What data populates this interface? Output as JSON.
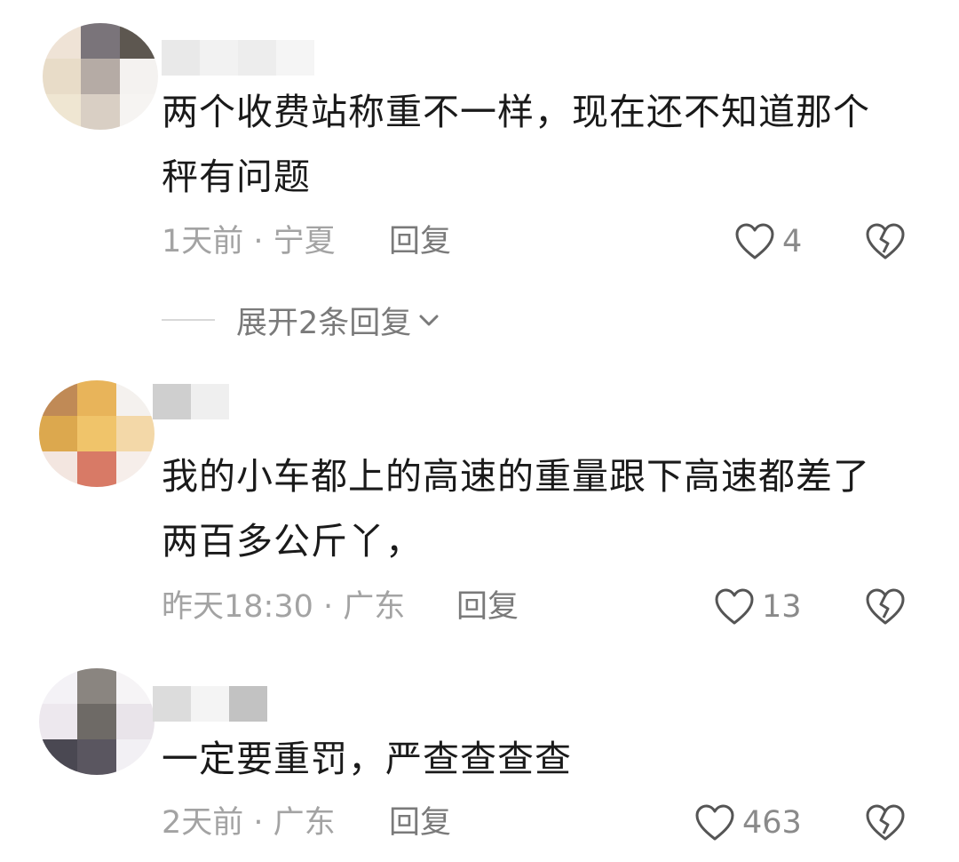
{
  "comments": [
    {
      "text": "两个收费站称重不一样，现在还不知道那个秤有问题",
      "time": "1天前 · 宁夏",
      "reply_label": "回复",
      "likes": "4",
      "expand_label": "展开2条回复"
    },
    {
      "text": "我的小车都上的高速的重量跟下高速都差了两百多公斤丫，",
      "time": "昨天18:30 · 广东",
      "reply_label": "回复",
      "likes": "13"
    },
    {
      "text": "一定要重罚，严查查查查",
      "time": "2天前 · 广东",
      "reply_label": "回复",
      "likes": "463"
    }
  ],
  "icons": {
    "like": "heart-outline-icon",
    "dislike": "broken-heart-icon",
    "expand": "chevron-down-icon"
  },
  "colors": {
    "text": "#1a1a1a",
    "meta": "#a3a3a3",
    "icon": "#555555"
  }
}
